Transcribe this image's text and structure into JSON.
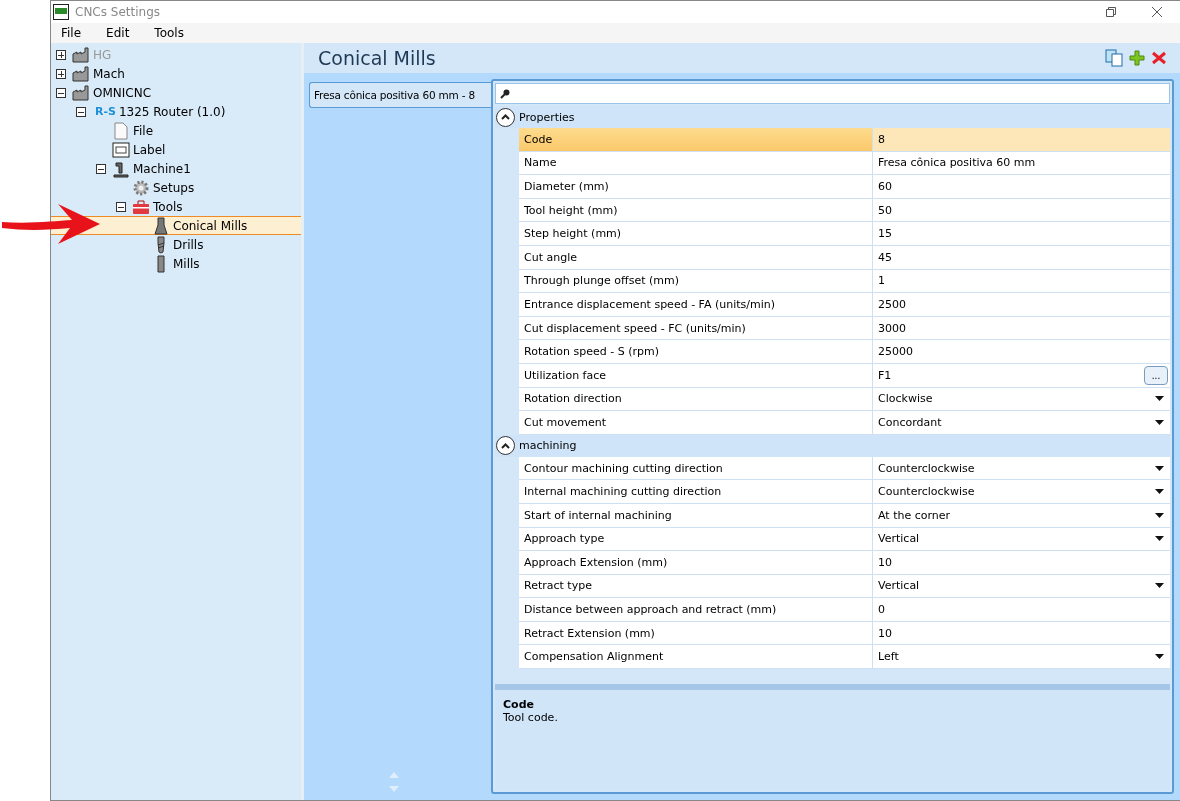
{
  "window": {
    "title": "CNCs Settings"
  },
  "menu": [
    "File",
    "Edit",
    "Tools"
  ],
  "tree": [
    {
      "label": "HG",
      "kind": "factory",
      "expanded": false,
      "disabled": true,
      "selected": false
    },
    {
      "label": "Mach",
      "kind": "factory",
      "expanded": false,
      "disabled": false,
      "selected": false
    },
    {
      "label": "OMNICNC",
      "kind": "factory",
      "expanded": true,
      "disabled": false,
      "selected": false,
      "children": [
        {
          "label": "1325 Router (1.0)",
          "logo": "R-S",
          "expanded": true,
          "disabled": false,
          "selected": false,
          "children": [
            {
              "label": "File",
              "kind": "file",
              "disabled": false,
              "selected": false
            },
            {
              "label": "Label",
              "kind": "label",
              "disabled": false,
              "selected": false
            },
            {
              "label": "Machine1",
              "kind": "machine",
              "expanded": true,
              "disabled": false,
              "selected": false,
              "children": [
                {
                  "label": "Setups",
                  "kind": "gear",
                  "disabled": false,
                  "selected": false
                },
                {
                  "label": "Tools",
                  "kind": "toolbox",
                  "expanded": true,
                  "disabled": false,
                  "selected": false,
                  "children": [
                    {
                      "label": "Conical Mills",
                      "kind": "conical",
                      "disabled": false,
                      "selected": true
                    },
                    {
                      "label": "Drills",
                      "kind": "drill",
                      "disabled": false,
                      "selected": false
                    },
                    {
                      "label": "Mills",
                      "kind": "mill",
                      "disabled": false,
                      "selected": false
                    }
                  ]
                }
              ]
            }
          ]
        }
      ]
    }
  ],
  "panel": {
    "title": "Conical Mills",
    "tools": [
      {
        "kind": "copy"
      },
      {
        "kind": "add"
      },
      {
        "kind": "delete"
      }
    ]
  },
  "items": [
    {
      "label": "Fresa cônica positiva 60 mm - 8",
      "selected": true
    }
  ],
  "property_grid": {
    "categories": [
      {
        "name": "Properties",
        "expanded": true,
        "rows": [
          {
            "name": "Code",
            "value": "8",
            "kind": "text",
            "selected": true
          },
          {
            "name": "Name",
            "value": "Fresa cônica positiva 60 mm",
            "kind": "text",
            "selected": false
          },
          {
            "name": "Diameter (mm)",
            "value": "60",
            "kind": "text",
            "selected": false
          },
          {
            "name": "Tool height (mm)",
            "value": "50",
            "kind": "text",
            "selected": false
          },
          {
            "name": "Step height (mm)",
            "value": "15",
            "kind": "text",
            "selected": false
          },
          {
            "name": "Cut angle",
            "value": "45",
            "kind": "text",
            "selected": false
          },
          {
            "name": "Through plunge offset (mm)",
            "value": "1",
            "kind": "text",
            "selected": false
          },
          {
            "name": "Entrance displacement speed - FA (units/min)",
            "value": "2500",
            "kind": "text",
            "selected": false
          },
          {
            "name": "Cut displacement speed - FC (units/min)",
            "value": "3000",
            "kind": "text",
            "selected": false
          },
          {
            "name": "Rotation speed - S (rpm)",
            "value": "25000",
            "kind": "text",
            "selected": false
          },
          {
            "name": "Utilization face",
            "value": "F1",
            "kind": "button",
            "button_label": "...",
            "selected": false
          },
          {
            "name": "Rotation direction",
            "value": "Clockwise",
            "kind": "dropdown",
            "selected": false
          },
          {
            "name": "Cut movement",
            "value": "Concordant",
            "kind": "dropdown",
            "selected": false
          }
        ]
      },
      {
        "name": "machining",
        "expanded": true,
        "rows": [
          {
            "name": "Contour machining cutting direction",
            "value": "Counterclockwise",
            "kind": "dropdown",
            "selected": false
          },
          {
            "name": "Internal machining cutting direction",
            "value": "Counterclockwise",
            "kind": "dropdown",
            "selected": false
          },
          {
            "name": "Start of internal machining",
            "value": "At the corner",
            "kind": "dropdown",
            "selected": false
          },
          {
            "name": "Approach type",
            "value": "Vertical",
            "kind": "dropdown",
            "selected": false
          },
          {
            "name": "Approach Extension (mm)",
            "value": "10",
            "kind": "text",
            "selected": false
          },
          {
            "name": "Retract type",
            "value": "Vertical",
            "kind": "dropdown",
            "selected": false
          },
          {
            "name": "Distance between approach and retract (mm)",
            "value": "0",
            "kind": "text",
            "selected": false
          },
          {
            "name": "Retract Extension (mm)",
            "value": "10",
            "kind": "text",
            "selected": false
          },
          {
            "name": "Compensation Alignment",
            "value": "Left",
            "kind": "dropdown",
            "selected": false
          }
        ]
      }
    ]
  },
  "description": {
    "title": "Code",
    "text": "Tool code."
  }
}
